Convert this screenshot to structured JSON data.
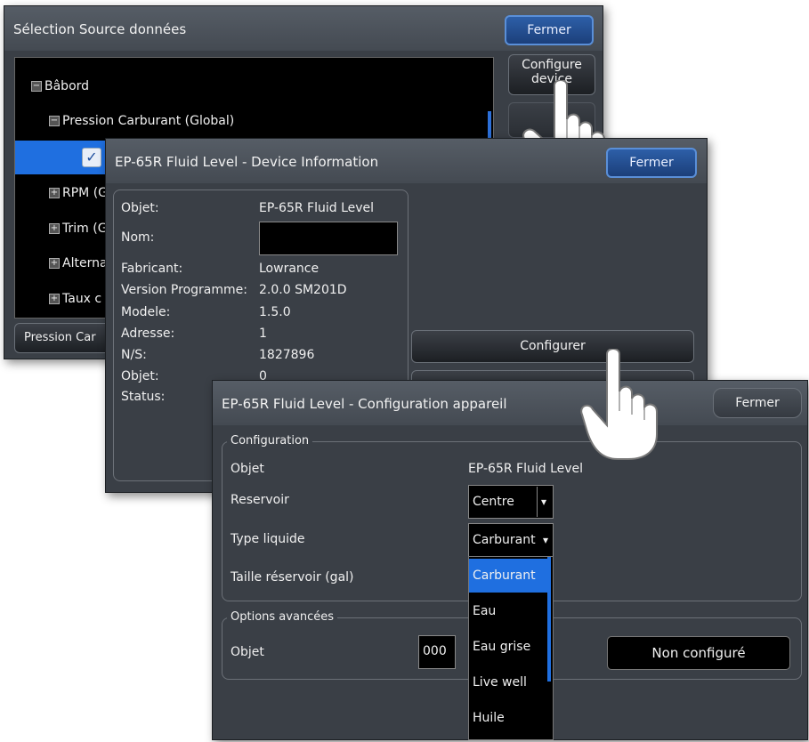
{
  "dialog1": {
    "title": "Sélection Source données",
    "close_label": "Fermer",
    "configure_device_label": "Configure device",
    "tree": [
      {
        "label": "Bâbord",
        "expander": "−"
      },
      {
        "label": "Pression Carburant (Global)",
        "expander": "−"
      },
      {
        "label": "",
        "checked": true
      },
      {
        "label": "RPM (G",
        "expander": "+"
      },
      {
        "label": "Trim (G",
        "expander": "+"
      },
      {
        "label": "Alterna",
        "expander": "+"
      },
      {
        "label": "Taux c",
        "expander": "+"
      }
    ],
    "footer_label": "Pression Car"
  },
  "dialog2": {
    "title": "EP-65R Fluid Level - Device Information",
    "close_label": "Fermer",
    "info": [
      {
        "label": "Objet:",
        "value": "EP-65R Fluid Level"
      },
      {
        "label": "Nom:",
        "value": ""
      },
      {
        "label": "Fabricant:",
        "value": "Lowrance"
      },
      {
        "label": "Version Programme:",
        "value": "2.0.0 SM201D"
      },
      {
        "label": "Modele:",
        "value": "1.5.0"
      },
      {
        "label": "Adresse:",
        "value": "1"
      },
      {
        "label": "N/S:",
        "value": "1827896"
      },
      {
        "label": "Objet:",
        "value": "0"
      },
      {
        "label": "Status:",
        "value": ""
      }
    ],
    "configure_label": "Configurer"
  },
  "dialog3": {
    "title": "EP-65R Fluid Level - Configuration appareil",
    "close_label": "Fermer",
    "config_group_title": "Configuration",
    "rows": {
      "objet_label": "Objet",
      "objet_value": "EP-65R Fluid Level",
      "reservoir_label": "Reservoir",
      "reservoir_value": "Centre",
      "type_label": "Type liquide",
      "type_value": "Carburant",
      "taille_label": "Taille réservoir (gal)"
    },
    "dropdown_options": [
      "Carburant",
      "Eau",
      "Eau grise",
      "Live well",
      "Huile"
    ],
    "dropdown_selected": "Carburant",
    "advanced_group_title": "Options avancées",
    "advanced_objet_label": "Objet",
    "advanced_objet_value": "000",
    "non_configure_label": "Non configuré"
  },
  "colors": {
    "panel": "#3a3f46",
    "highlight": "#1f6fe0",
    "button_blue": "#2d5fa8"
  }
}
